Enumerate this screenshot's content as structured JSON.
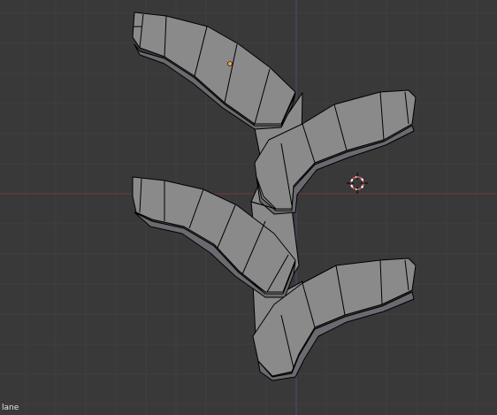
{
  "viewport": {
    "object_label": "lane",
    "colors": {
      "background": "#393939",
      "grid": "#404040",
      "axis_x": "#6e3a3a",
      "axis_y": "#4a4a7a",
      "mesh_face": "#8a8a8a",
      "mesh_side": "#6a6a70",
      "origin_dot": "#f0a040"
    },
    "icons": {
      "cursor": "3d-cursor-icon",
      "origin": "object-origin-icon"
    }
  }
}
